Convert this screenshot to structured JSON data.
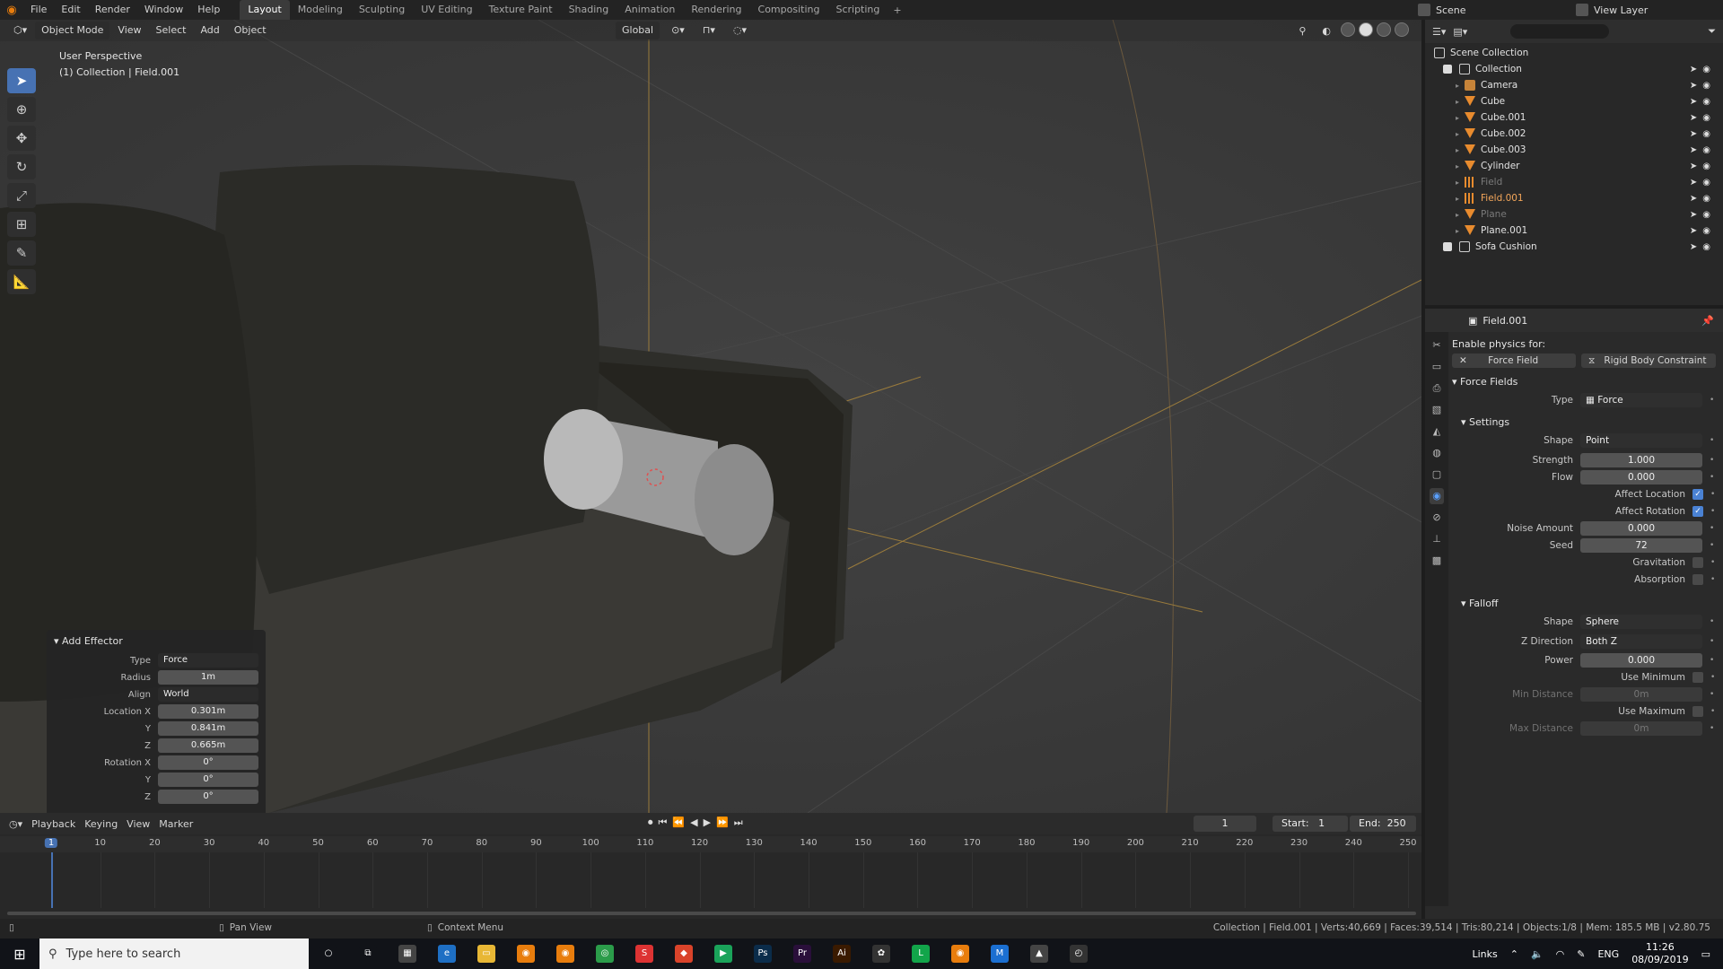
{
  "topbar": {
    "menus": [
      "File",
      "Edit",
      "Render",
      "Window",
      "Help"
    ],
    "workspaces": [
      "Layout",
      "Modeling",
      "Sculpting",
      "UV Editing",
      "Texture Paint",
      "Shading",
      "Animation",
      "Rendering",
      "Compositing",
      "Scripting"
    ],
    "active_workspace": "Layout",
    "add_workspace": "+",
    "scene": "Scene",
    "view_layer": "View Layer"
  },
  "viewport": {
    "mode": "Object Mode",
    "menus": [
      "View",
      "Select",
      "Add",
      "Object"
    ],
    "orientation": "Global",
    "info_line1": "User Perspective",
    "info_line2": "(1) Collection | Field.001"
  },
  "redo_panel": {
    "title": "Add Effector",
    "type_label": "Type",
    "type_value": "Force",
    "radius_label": "Radius",
    "radius_value": "1m",
    "align_label": "Align",
    "align_value": "World",
    "loc_x_label": "Location X",
    "loc_x": "0.301m",
    "loc_y_label": "Y",
    "loc_y": "0.841m",
    "loc_z_label": "Z",
    "loc_z": "0.665m",
    "rot_x_label": "Rotation X",
    "rot_x": "0°",
    "rot_y_label": "Y",
    "rot_y": "0°",
    "rot_z_label": "Z",
    "rot_z": "0°"
  },
  "outliner": {
    "scene_collection": "Scene Collection",
    "items": [
      {
        "name": "Collection",
        "icon": "collection-icon",
        "state": "normal"
      },
      {
        "name": "Camera",
        "icon": "camera-icon",
        "state": "normal"
      },
      {
        "name": "Cube",
        "icon": "mesh-icon",
        "state": "normal"
      },
      {
        "name": "Cube.001",
        "icon": "mesh-icon",
        "state": "normal"
      },
      {
        "name": "Cube.002",
        "icon": "mesh-icon",
        "state": "normal"
      },
      {
        "name": "Cube.003",
        "icon": "mesh-icon",
        "state": "normal"
      },
      {
        "name": "Cylinder",
        "icon": "mesh-icon",
        "state": "normal"
      },
      {
        "name": "Field",
        "icon": "field-icon",
        "state": "dim"
      },
      {
        "name": "Field.001",
        "icon": "field-icon",
        "state": "selected"
      },
      {
        "name": "Plane",
        "icon": "mesh-icon",
        "state": "dim"
      },
      {
        "name": "Plane.001",
        "icon": "mesh-icon",
        "state": "normal"
      },
      {
        "name": "Sofa Cushion",
        "icon": "collection-icon",
        "state": "normal"
      }
    ]
  },
  "properties": {
    "object_name": "Field.001",
    "enable_physics": "Enable physics for:",
    "force_field_btn": "Force Field",
    "rigid_body_btn": "Rigid Body Constraint",
    "section_force_fields": "Force Fields",
    "type_label": "Type",
    "type_value": "Force",
    "section_settings": "Settings",
    "shape_label": "Shape",
    "shape_value": "Point",
    "strength_label": "Strength",
    "strength": "1.000",
    "flow_label": "Flow",
    "flow": "0.000",
    "affect_location": "Affect Location",
    "affect_rotation": "Affect Rotation",
    "noise_label": "Noise Amount",
    "noise": "0.000",
    "seed_label": "Seed",
    "seed": "72",
    "gravitation": "Gravitation",
    "absorption": "Absorption",
    "section_falloff": "Falloff",
    "falloff_shape_label": "Shape",
    "falloff_shape": "Sphere",
    "zdir_label": "Z Direction",
    "zdir": "Both Z",
    "power_label": "Power",
    "power": "0.000",
    "use_min": "Use Minimum",
    "min_label": "Min Distance",
    "min_val": "0m",
    "use_max": "Use Maximum",
    "max_label": "Max Distance",
    "max_val": "0m"
  },
  "timeline": {
    "menus": [
      "Playback",
      "Keying",
      "View",
      "Marker"
    ],
    "current_frame": "1",
    "start_label": "Start:",
    "start": "1",
    "end_label": "End:",
    "end": "250",
    "ruler": [
      "1",
      "10",
      "20",
      "30",
      "40",
      "50",
      "60",
      "70",
      "80",
      "90",
      "100",
      "110",
      "120",
      "130",
      "140",
      "150",
      "160",
      "170",
      "180",
      "190",
      "200",
      "210",
      "220",
      "230",
      "240",
      "250"
    ]
  },
  "statusbar": {
    "pan_view": "Pan View",
    "context_menu": "Context Menu",
    "stats": "Collection | Field.001 | Verts:40,669 | Faces:39,514 | Tris:80,214 | Objects:1/8 | Mem: 185.5 MB | v2.80.75"
  },
  "taskbar": {
    "search_placeholder": "Type here to search",
    "apps": [
      {
        "name": "cortana",
        "glyph": "○",
        "color": "#111318"
      },
      {
        "name": "task-view",
        "glyph": "⧉",
        "color": "#111318"
      },
      {
        "name": "calculator",
        "glyph": "▦",
        "color": "#444"
      },
      {
        "name": "edge",
        "glyph": "e",
        "color": "#1e6fc4"
      },
      {
        "name": "explorer",
        "glyph": "▭",
        "color": "#e8b735"
      },
      {
        "name": "blender-a",
        "glyph": "◉",
        "color": "#e87d0d"
      },
      {
        "name": "blender-b",
        "glyph": "◉",
        "color": "#e87d0d"
      },
      {
        "name": "chrome",
        "glyph": "◎",
        "color": "#2b9c4a"
      },
      {
        "name": "app-red-a",
        "glyph": "S",
        "color": "#d33"
      },
      {
        "name": "app-red-b",
        "glyph": "◆",
        "color": "#d9432a"
      },
      {
        "name": "media-player",
        "glyph": "▶",
        "color": "#1aa35a"
      },
      {
        "name": "photoshop",
        "glyph": "Ps",
        "color": "#0b2c4a"
      },
      {
        "name": "premiere",
        "glyph": "Pr",
        "color": "#2a0f3a"
      },
      {
        "name": "illustrator",
        "glyph": "Ai",
        "color": "#3a1a00"
      },
      {
        "name": "app-colors",
        "glyph": "✿",
        "color": "#333"
      },
      {
        "name": "line",
        "glyph": "L",
        "color": "#12a54a"
      },
      {
        "name": "blender-active",
        "glyph": "◉",
        "color": "#e87d0d"
      },
      {
        "name": "app-blue-m",
        "glyph": "M",
        "color": "#1b6fd1"
      },
      {
        "name": "photos",
        "glyph": "▲",
        "color": "#444"
      },
      {
        "name": "app-clock",
        "glyph": "◴",
        "color": "#333"
      }
    ],
    "links": "Links",
    "lang": "ENG",
    "time": "11:26",
    "date": "08/09/2019"
  }
}
